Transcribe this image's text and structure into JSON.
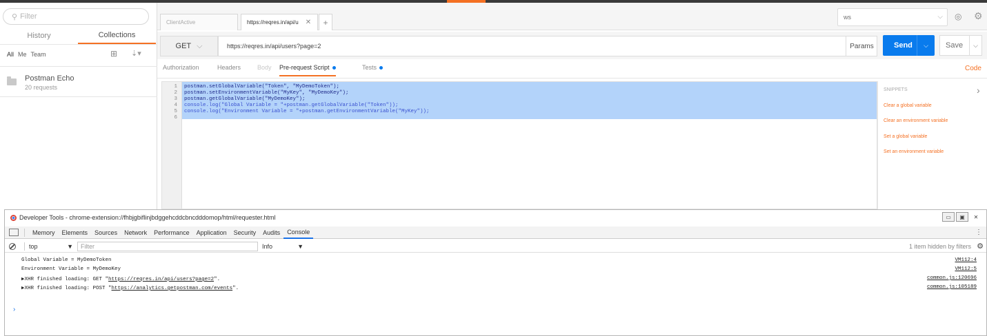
{
  "sidebar": {
    "filter_placeholder": "Filter",
    "tabs": {
      "history": "History",
      "collections": "Collections"
    },
    "scope": {
      "all": "All",
      "me": "Me",
      "team": "Team"
    },
    "collection": {
      "name": "Postman Echo",
      "count": "20 requests"
    }
  },
  "tabs": {
    "client": "ClientActive",
    "request": "https://reqres.in/api/u",
    "close": "✕",
    "plus": "+"
  },
  "environment": {
    "selected": "ws"
  },
  "request": {
    "method": "GET",
    "url": "https://reqres.in/api/users?page=2",
    "params": "Params",
    "send": "Send",
    "save": "Save"
  },
  "request_tabs": {
    "authorization": "Authorization",
    "headers": "Headers",
    "body": "Body",
    "prerequest": "Pre-request Script",
    "tests": "Tests",
    "code": "Code"
  },
  "editor": {
    "line_numbers": [
      "1",
      "2",
      "3",
      "4",
      "5",
      "6"
    ],
    "lines": [
      "postman.setGlobalVariable(\"Token\", \"MyDemoToken\");",
      "postman.setEnvironmentVariable(\"MyKey\", \"MyDemoKey\");",
      "postman.getGlobalVariable(\"MyDemoKey\");",
      "console.log(\"Global Variable = \"+postman.getGlobalVariable(\"Token\"));",
      "console.log(\"Environment Variable = \"+postman.getEnvironmentVariable(\"MyKey\"));",
      ""
    ]
  },
  "snippets": {
    "title": "SNIPPETS",
    "items": [
      "Clear a global variable",
      "Clear an environment variable",
      "Set a global variable",
      "Set an environment variable"
    ]
  },
  "devtools": {
    "title": "Developer Tools - chrome-extension://fhbjgbiflinjbdggehcddcbncdddomop/html/requester.html",
    "tabs": [
      "Memory",
      "Elements",
      "Sources",
      "Network",
      "Performance",
      "Application",
      "Security",
      "Audits",
      "Console"
    ],
    "context": "top",
    "filter_placeholder": "Filter",
    "levels": "Info",
    "hidden_note": "1 item hidden by filters",
    "logs": [
      {
        "msg": "Global Variable = MyDemoToken",
        "src": "VM112:4"
      },
      {
        "msg": "Environment Variable = MyDemoKey",
        "src": "VM112:5"
      },
      {
        "prefix": "▶XHR finished loading: GET \"",
        "link": "https://reqres.in/api/users?page=2",
        "suffix": "\".",
        "src": "common.js:120696"
      },
      {
        "prefix": "▶XHR finished loading: POST \"",
        "link": "https://analytics.getpostman.com/events",
        "suffix": "\".",
        "src": "common.js:105189"
      }
    ],
    "prompt": "›"
  },
  "colors": {
    "accent": "#f47023",
    "send": "#097bed",
    "selection": "#b3d3fa"
  }
}
